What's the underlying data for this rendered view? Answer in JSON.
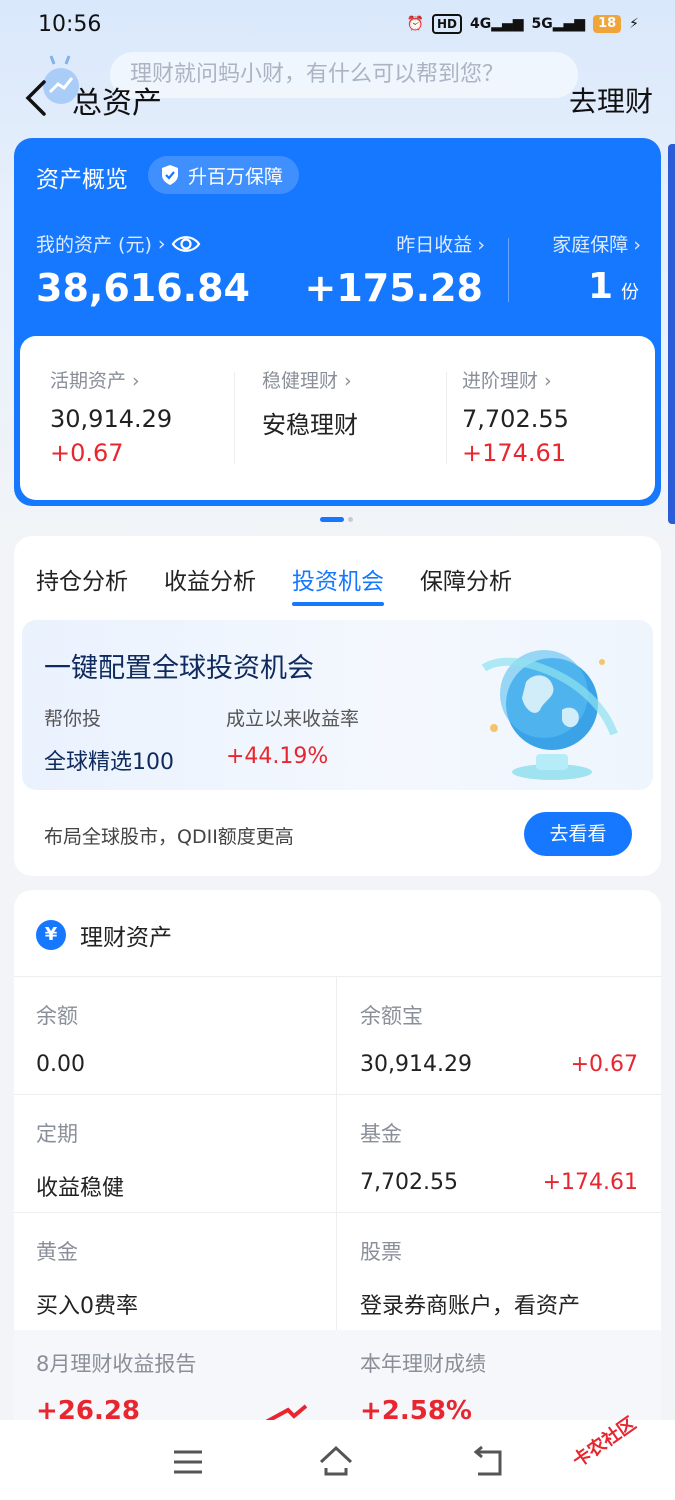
{
  "status": {
    "time": "10:56",
    "hd": "HD",
    "net1": "4G",
    "net2": "5G",
    "battery": "18"
  },
  "header": {
    "title": "总资产",
    "search_placeholder": "理财就问蚂小财，有什么可以帮到您？",
    "right_action": "去理财"
  },
  "overview": {
    "title": "资产概览",
    "guard_label": "升百万保障",
    "my_asset_label": "我的资产 (元)",
    "my_asset_value": "38,616.84",
    "yesterday_label": "昨日收益",
    "yesterday_value": "+175.28",
    "family_label": "家庭保障",
    "family_value": "1",
    "family_unit": "份",
    "sub": [
      {
        "label": "活期资产",
        "value": "30,914.29",
        "delta": "+0.67"
      },
      {
        "label": "稳健理财",
        "value": "安稳理财",
        "delta": ""
      },
      {
        "label": "进阶理财",
        "value": "7,702.55",
        "delta": "+174.61"
      }
    ]
  },
  "analysis": {
    "tabs": [
      "持仓分析",
      "收益分析",
      "投资机会",
      "保障分析"
    ],
    "active_tab": 2,
    "promo": {
      "title": "一键配置全球投资机会",
      "label1": "帮你投",
      "label2": "成立以来收益率",
      "value1": "全球精选100",
      "value2": "+44.19%"
    },
    "footer_text": "布局全球股市，QDII额度更高",
    "cta": "去看看"
  },
  "assets": {
    "title": "理财资产",
    "cells": [
      {
        "label": "余额",
        "value": "0.00",
        "delta": ""
      },
      {
        "label": "余额宝",
        "value": "30,914.29",
        "delta": "+0.67"
      },
      {
        "label": "定期",
        "value": "收益稳健",
        "delta": ""
      },
      {
        "label": "基金",
        "value": "7,702.55",
        "delta": "+174.61"
      },
      {
        "label": "黄金",
        "value": "买入0费率",
        "delta": ""
      },
      {
        "label": "股票",
        "value": "登录券商账户，看资产",
        "delta": ""
      }
    ],
    "report_left_label": "8月理财收益报告",
    "report_left_value": "+26.28",
    "report_right_label": "本年理财成绩",
    "report_right_value": "+2.58%"
  },
  "watermark": "卡农社区",
  "colors": {
    "accent": "#1677ff",
    "up": "#e8262f"
  }
}
